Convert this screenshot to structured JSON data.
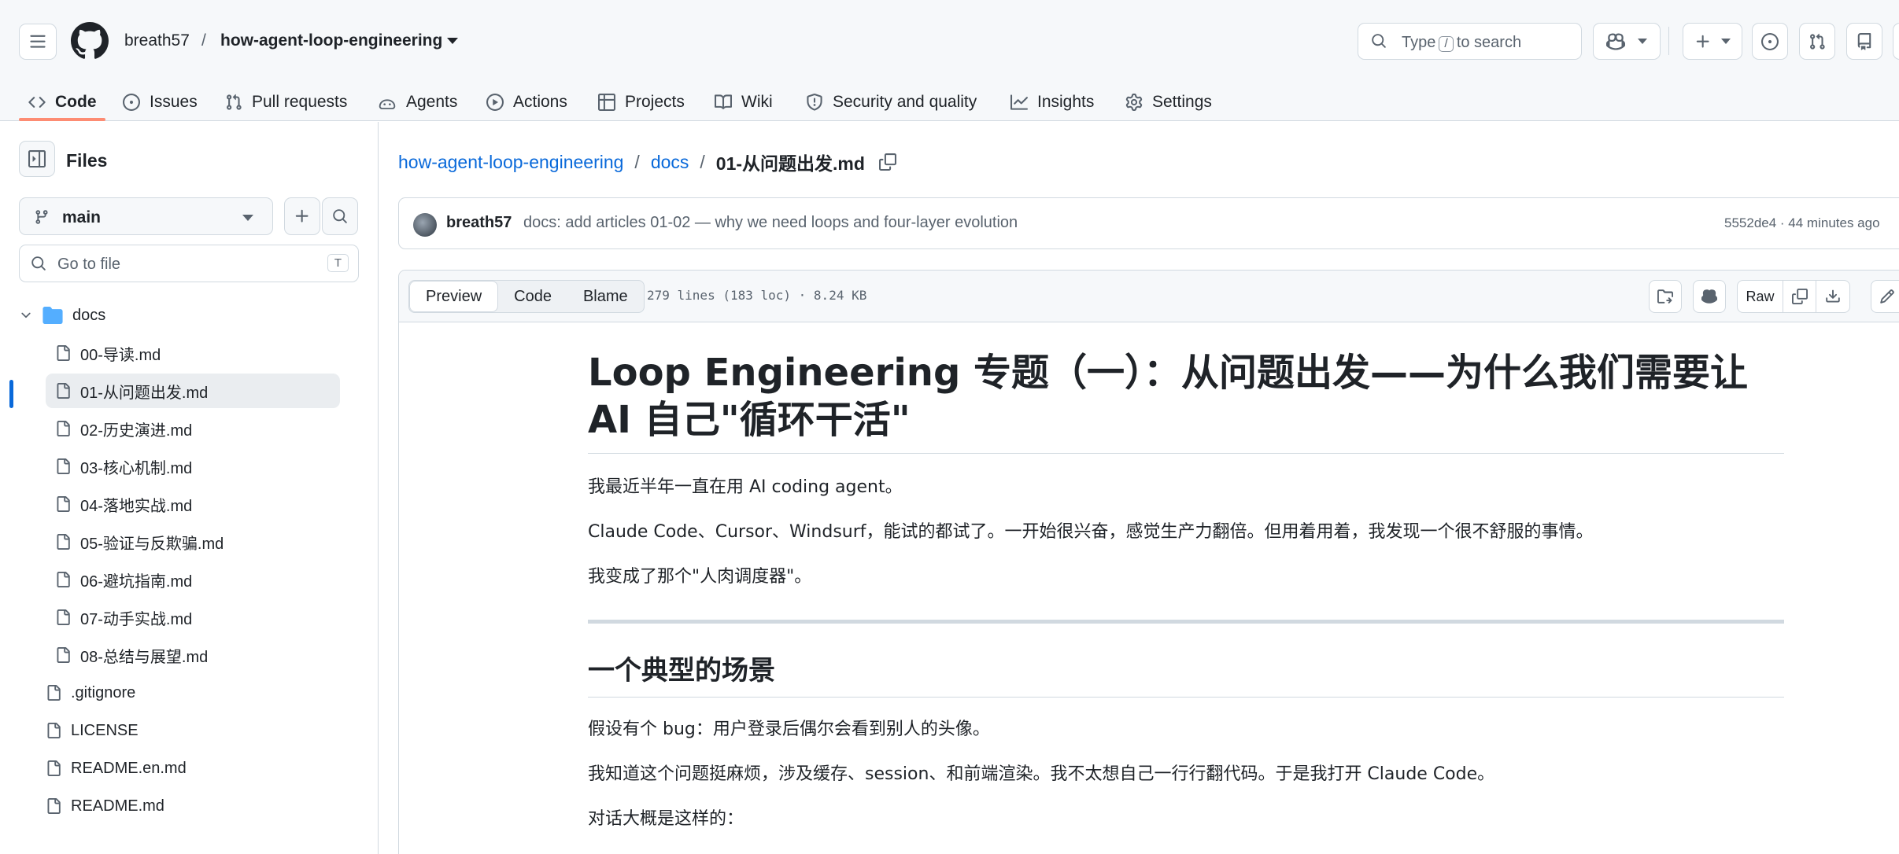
{
  "header": {
    "owner": "breath57",
    "repo": "how-agent-loop-engineering",
    "search_prefix": "Type",
    "search_key": "/",
    "search_suffix": "to search"
  },
  "repo_nav": {
    "items": [
      {
        "label": "Code",
        "icon": "code-icon"
      },
      {
        "label": "Issues",
        "icon": "issue-icon"
      },
      {
        "label": "Pull requests",
        "icon": "pull-request-icon"
      },
      {
        "label": "Agents",
        "icon": "agent-icon"
      },
      {
        "label": "Actions",
        "icon": "play-icon"
      },
      {
        "label": "Projects",
        "icon": "table-icon"
      },
      {
        "label": "Wiki",
        "icon": "book-icon"
      },
      {
        "label": "Security and quality",
        "icon": "shield-icon"
      },
      {
        "label": "Insights",
        "icon": "graph-icon"
      },
      {
        "label": "Settings",
        "icon": "gear-icon"
      }
    ],
    "selected": "Code"
  },
  "sidebar": {
    "title": "Files",
    "branch": "main",
    "goto_placeholder": "Go to file",
    "goto_key": "T",
    "tree": [
      {
        "label": "docs",
        "type": "folder",
        "expanded": true
      },
      {
        "label": "00-导读.md",
        "type": "file"
      },
      {
        "label": "01-从问题出发.md",
        "type": "file",
        "selected": true
      },
      {
        "label": "02-历史演进.md",
        "type": "file"
      },
      {
        "label": "03-核心机制.md",
        "type": "file"
      },
      {
        "label": "04-落地实战.md",
        "type": "file"
      },
      {
        "label": "05-验证与反欺骗.md",
        "type": "file"
      },
      {
        "label": "06-避坑指南.md",
        "type": "file"
      },
      {
        "label": "07-动手实战.md",
        "type": "file"
      },
      {
        "label": "08-总结与展望.md",
        "type": "file"
      },
      {
        "label": ".gitignore",
        "type": "file"
      },
      {
        "label": "LICENSE",
        "type": "file"
      },
      {
        "label": "README.en.md",
        "type": "file"
      },
      {
        "label": "README.md",
        "type": "file"
      }
    ]
  },
  "path": {
    "repo": "how-agent-loop-engineering",
    "dir": "docs",
    "file": "01-从问题出发.md"
  },
  "commit": {
    "author": "breath57",
    "message": "docs: add articles 01-02 — why we need loops and four-layer evolution",
    "meta": "5552de4 · 44 minutes ago"
  },
  "file": {
    "tabs": [
      "Preview",
      "Code",
      "Blame"
    ],
    "active_tab": "Preview",
    "meta": "279 lines (183 loc) · 8.24 KB",
    "raw_label": "Raw"
  },
  "content": {
    "h1": "Loop Engineering 专题（一）：从问题出发——为什么我们需要让 AI 自己\"循环干活\"",
    "p1": "我最近半年一直在用 AI coding agent。",
    "p2": "Claude Code、Cursor、Windsurf，能试的都试了。一开始很兴奋，感觉生产力翻倍。但用着用着，我发现一个很不舒服的事情。",
    "p3": "我变成了那个\"人肉调度器\"。",
    "h2": "一个典型的场景",
    "p4": "假设有个 bug：用户登录后偶尔会看到别人的头像。",
    "p5": "我知道这个问题挺麻烦，涉及缓存、session、和前端渲染。我不太想自己一行行翻代码。于是我打开 Claude Code。",
    "p6": "对话大概是这样的："
  }
}
